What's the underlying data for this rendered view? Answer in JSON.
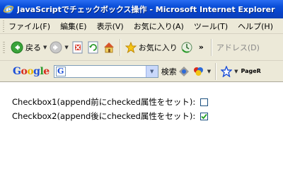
{
  "window": {
    "title": "JavaScriptでチェックボックス操作 - Microsoft Internet Explorer"
  },
  "menubar": {
    "items": [
      "ファイル(F)",
      "編集(E)",
      "表示(V)",
      "お気に入り(A)",
      "ツール(T)",
      "ヘルプ(H)"
    ]
  },
  "toolbar": {
    "back_label": "戻る",
    "favorites_label": "お気に入り",
    "more_label": "»",
    "address_label": "アドレス(D)"
  },
  "google_bar": {
    "logo": "Google",
    "search_box_g": "G",
    "search_label": "検索",
    "pagerank_label": "PageR"
  },
  "content": {
    "checkbox1_label": "Checkbox1(append前にchecked属性をセット):",
    "checkbox1_checked": false,
    "checkbox2_label": "Checkbox2(append後にchecked属性をセット):",
    "checkbox2_checked": true
  },
  "colors": {
    "titlebar": "#0a4fd8",
    "chrome": "#ece9d8",
    "checkmark": "#21a121"
  }
}
